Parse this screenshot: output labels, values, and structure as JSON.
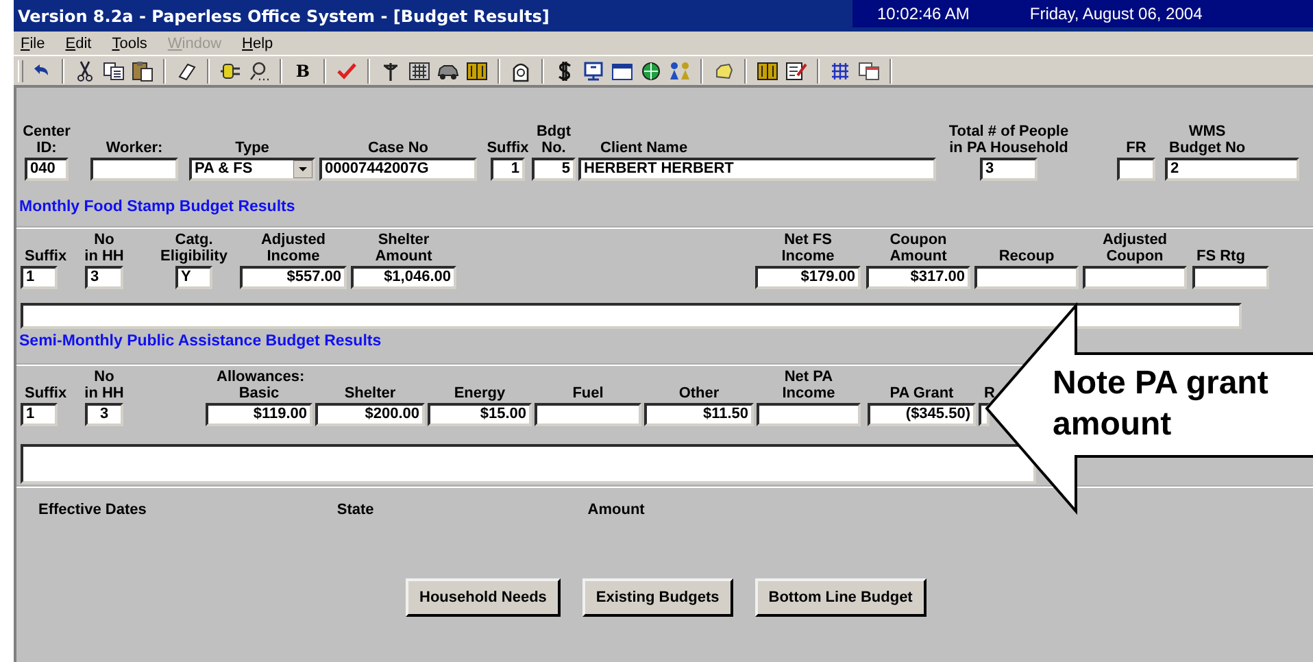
{
  "window": {
    "title": "Version 8.2a - Paperless Office System - [Budget Results]",
    "time": "10:02:46 AM",
    "date": "Friday, August 06, 2004"
  },
  "menu": [
    {
      "label": "File",
      "disabled": false
    },
    {
      "label": "Edit",
      "disabled": false
    },
    {
      "label": "Tools",
      "disabled": false
    },
    {
      "label": "Window",
      "disabled": true
    },
    {
      "label": "Help",
      "disabled": false
    }
  ],
  "toolbar": {
    "bold_button": "B"
  },
  "header": {
    "fields": [
      {
        "label": "Center\nID:",
        "value": "040"
      },
      {
        "label": "Worker:"
      },
      {
        "label": "Type",
        "value": "PA & FS",
        "kind": "dropdown"
      },
      {
        "label": "Case No",
        "value": "00007442007G"
      },
      {
        "label": "Suffix",
        "value": "1"
      },
      {
        "label": "Bdgt\nNo.",
        "value": "5"
      },
      {
        "label": "Client Name",
        "value": "HERBERT HERBERT"
      },
      {
        "label": "Total # of People\nin PA Household",
        "value": "3"
      },
      {
        "label": "FR"
      },
      {
        "label": "WMS\nBudget No",
        "value": "2"
      }
    ]
  },
  "food_stamp": {
    "heading": "Monthly Food Stamp Budget Results",
    "fields": [
      {
        "label": "Suffix",
        "value": "1"
      },
      {
        "label": "No\nin HH",
        "value": "3"
      },
      {
        "label": "Catg.\nEligibility",
        "value": "Y"
      },
      {
        "label": "Adjusted\nIncome",
        "value": "$557.00"
      },
      {
        "label": "Shelter\nAmount",
        "value": "$1,046.00"
      },
      {
        "label": "Net FS\nIncome",
        "value": "$179.00"
      },
      {
        "label": "Coupon\nAmount",
        "value": "$317.00"
      },
      {
        "label": "Recoup"
      },
      {
        "label": "Adjusted\nCoupon"
      },
      {
        "label": "FS Rtg"
      }
    ]
  },
  "public_assistance": {
    "heading": "Semi-Monthly Public Assistance Budget Results",
    "fields": [
      {
        "label": "Suffix",
        "value": "1"
      },
      {
        "label": "No\nin HH",
        "value": "3"
      },
      {
        "group_label": "Allowances:",
        "label": "Basic",
        "value": "$119.00"
      },
      {
        "label": "Shelter",
        "value": "$200.00"
      },
      {
        "label": "Energy",
        "value": "$15.00"
      },
      {
        "label": "Fuel"
      },
      {
        "label": "Other",
        "value": "$11.50"
      },
      {
        "label": "Net PA\nIncome"
      },
      {
        "label": "PA Grant",
        "value": "($345.50)"
      },
      {
        "label": "R"
      }
    ]
  },
  "effective": {
    "columns": [
      "Effective Dates",
      "State",
      "Amount"
    ]
  },
  "buttons": [
    "Household Needs",
    "Existing Budgets",
    "Bottom Line Budget"
  ],
  "callout": {
    "text": "Note PA grant amount"
  }
}
